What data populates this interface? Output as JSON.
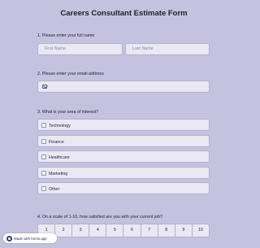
{
  "form": {
    "title": "Careers Consultant Estimate Form",
    "q1": {
      "label": "1. Please enter your full name",
      "first_placeholder": "First Name",
      "last_placeholder": "Last Name"
    },
    "q2": {
      "label": "2. Please enter your email address",
      "icon": "email-icon"
    },
    "q3": {
      "label": "3. What is your area of interest?",
      "options": [
        "Technology",
        "Finance",
        "Healthcare",
        "Marketing",
        "Other"
      ]
    },
    "q4": {
      "label": "4. On a scale of 1-10, how satisfied are you with your current job?",
      "scale": [
        "1",
        "2",
        "3",
        "4",
        "5",
        "6",
        "7",
        "8",
        "9",
        "10"
      ]
    }
  },
  "badge": {
    "label": "Made with forms.app",
    "icon": "forms-app-logo-icon"
  }
}
